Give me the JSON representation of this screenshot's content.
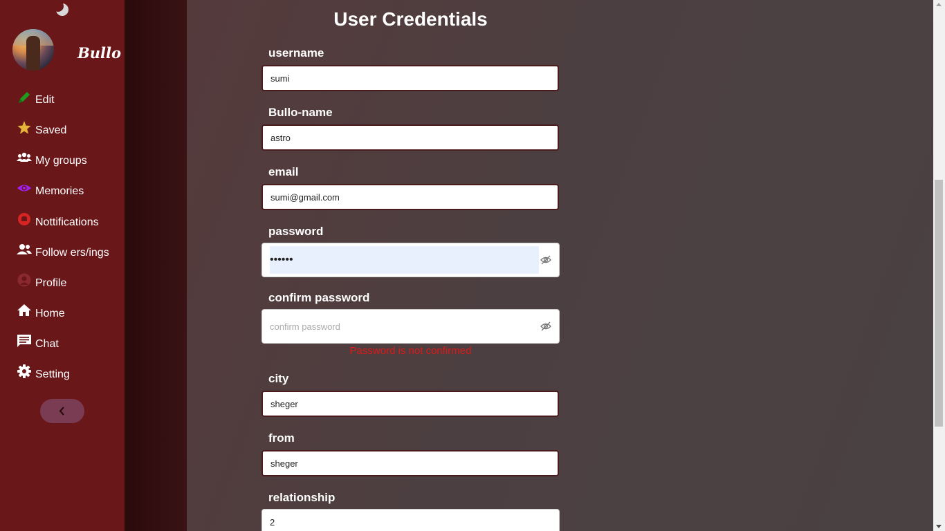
{
  "sidebar": {
    "brand": "Bullo",
    "items": [
      {
        "label": "Edit",
        "icon": "pencil-icon",
        "color": "#1f9a1f"
      },
      {
        "label": "Saved",
        "icon": "star-icon",
        "color": "#e6b43a"
      },
      {
        "label": "My groups",
        "icon": "groups-icon",
        "color": "#ffffff"
      },
      {
        "label": "Memories",
        "icon": "eye-icon",
        "color": "#a020f0"
      },
      {
        "label": "Nottifications",
        "icon": "bell-icon",
        "color": "#d92424"
      },
      {
        "label": "Follow ers/ings",
        "icon": "people-icon",
        "color": "#ffffff"
      },
      {
        "label": "Profile",
        "icon": "person-icon",
        "color": "#8a2a30"
      },
      {
        "label": "Home",
        "icon": "home-icon",
        "color": "#ffffff"
      },
      {
        "label": "Chat",
        "icon": "chat-icon",
        "color": "#ffffff"
      },
      {
        "label": "Setting",
        "icon": "gear-icon",
        "color": "#ffffff"
      }
    ]
  },
  "form": {
    "title": "User Credentials",
    "username": {
      "label": "username",
      "value": "sumi"
    },
    "bullo_name": {
      "label": "Bullo-name",
      "value": "astro"
    },
    "email": {
      "label": "email",
      "value": "sumi@gmail.com"
    },
    "password": {
      "label": "password",
      "value": "••••••"
    },
    "confirm_password": {
      "label": "confirm password",
      "placeholder": "confirm password"
    },
    "error": "Password is not confirmed",
    "city": {
      "label": "city",
      "value": "sheger"
    },
    "from": {
      "label": "from",
      "value": "sheger"
    },
    "relationship": {
      "label": "relationship",
      "value": "2"
    }
  }
}
